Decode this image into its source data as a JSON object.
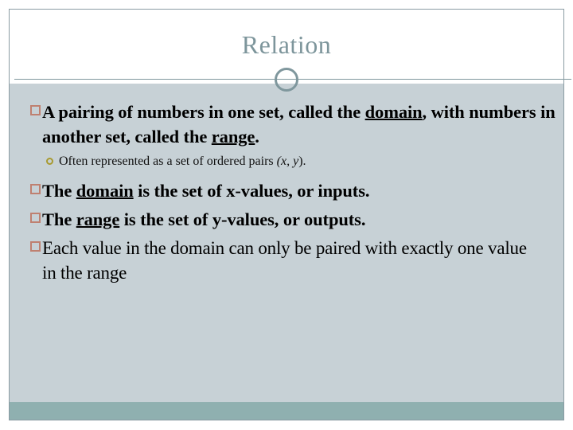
{
  "slide": {
    "title": "Relation",
    "colors": {
      "title_text": "#7d959b",
      "divider": "#7f979d",
      "body_background": "#c7d1d6",
      "footer_bar": "#8fb0b0",
      "header_background": "#ffffff",
      "square_bullet": "#bf8070",
      "circle_bullet": "#a89a30",
      "body_text": "#000000",
      "frame_border": "#8a9ba3"
    }
  },
  "content": {
    "bullets": [
      {
        "level": 1,
        "bullet_glyph": "hollow-square",
        "segments": [
          {
            "text": "A pairing of numbers in one set, called the ",
            "style": "plain"
          },
          {
            "text": "domain",
            "style": "bold-underline"
          },
          {
            "text": ", with numbers in another set, called the ",
            "style": "plain"
          },
          {
            "text": "range",
            "style": "bold-underline"
          },
          {
            "text": ".",
            "style": "plain"
          }
        ],
        "plain_text": "A pairing of numbers in one set, called the domain, with numbers in another set, called the range."
      },
      {
        "level": 2,
        "bullet_glyph": "hollow-circle",
        "segments": [
          {
            "text": "Often represented as a set of ordered pairs ",
            "style": "plain"
          },
          {
            "text": "(x, y",
            "style": "italic"
          },
          {
            "text": ").",
            "style": "plain"
          }
        ],
        "plain_text": "Often represented as a set of ordered pairs (x, y)."
      },
      {
        "level": 1,
        "bullet_glyph": "hollow-square",
        "segments": [
          {
            "text": "The ",
            "style": "plain"
          },
          {
            "text": "domain",
            "style": "bold-underline"
          },
          {
            "text": " is the set of x-values, or inputs.",
            "style": "plain"
          }
        ],
        "plain_text": "The domain is the set of x-values, or inputs."
      },
      {
        "level": 1,
        "bullet_glyph": "hollow-square",
        "segments": [
          {
            "text": "The ",
            "style": "plain"
          },
          {
            "text": "range",
            "style": "bold-underline"
          },
          {
            "text": " is the set of y-values, or outputs.",
            "style": "plain"
          }
        ],
        "plain_text": "The range is the set of y-values, or outputs."
      },
      {
        "level": 1,
        "bullet_glyph": "hollow-square",
        "segments": [
          {
            "text": "Each value in the domain can only be paired with exactly one value in the range",
            "style": "plain"
          }
        ],
        "plain_text": "Each value in the domain can only be paired with exactly one value in the range"
      }
    ]
  }
}
